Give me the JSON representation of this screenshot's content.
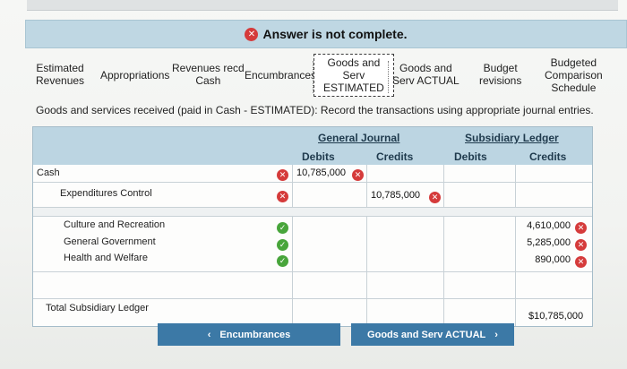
{
  "banner": {
    "icon": "x-circle-icon",
    "text": "Answer is not complete."
  },
  "tabs": {
    "estimated_revenues": "Estimated\nRevenues",
    "appropriations": "Appropriations",
    "revenues_recd_cash": "Revenues recd\nCash",
    "encumbrances": "Encumbrances",
    "goods_serv_estimated": "Goods and\nServ\nESTIMATED",
    "goods_serv_actual": "Goods and\nServ ACTUAL",
    "budget_revisions": "Budget\nrevisions",
    "budgeted_comparison": "Budgeted\nComparison\nSchedule"
  },
  "instruction": "Goods and services received (paid in Cash - ESTIMATED): Record the transactions using appropriate journal entries.",
  "journal": {
    "general_journal": "General Journal",
    "subsidiary_ledger": "Subsidiary Ledger",
    "debits": "Debits",
    "credits": "Credits",
    "sub_debits": "Debits",
    "sub_credits": "Credits",
    "rows": [
      {
        "account": "Cash",
        "status": "x",
        "gj_debit": "10,785,000",
        "gj_debit_status": "x",
        "gj_credit": "",
        "sl_debit": "",
        "sl_credit": ""
      },
      {
        "account": "Expenditures Control",
        "status": "x",
        "gj_debit": "",
        "gj_credit": "10,785,000",
        "gj_credit_status": "x",
        "sl_debit": "",
        "sl_credit": ""
      }
    ],
    "sub_rows": [
      {
        "account": "Culture and Recreation",
        "status": "ok",
        "sl_credit": "4,610,000",
        "sl_credit_status": "x"
      },
      {
        "account": "General Government",
        "status": "ok",
        "sl_credit": "5,285,000",
        "sl_credit_status": "x"
      },
      {
        "account": "Health and Welfare",
        "status": "ok",
        "sl_credit": "890,000",
        "sl_credit_status": "x"
      }
    ],
    "total_label": "Total Subsidiary Ledger",
    "total_value": "$10,785,000"
  },
  "nav": {
    "prev_label": "Encumbrances",
    "prev_icon": "chevron-left-icon",
    "next_label": "Goods and Serv ACTUAL",
    "next_icon": "chevron-right-icon"
  }
}
